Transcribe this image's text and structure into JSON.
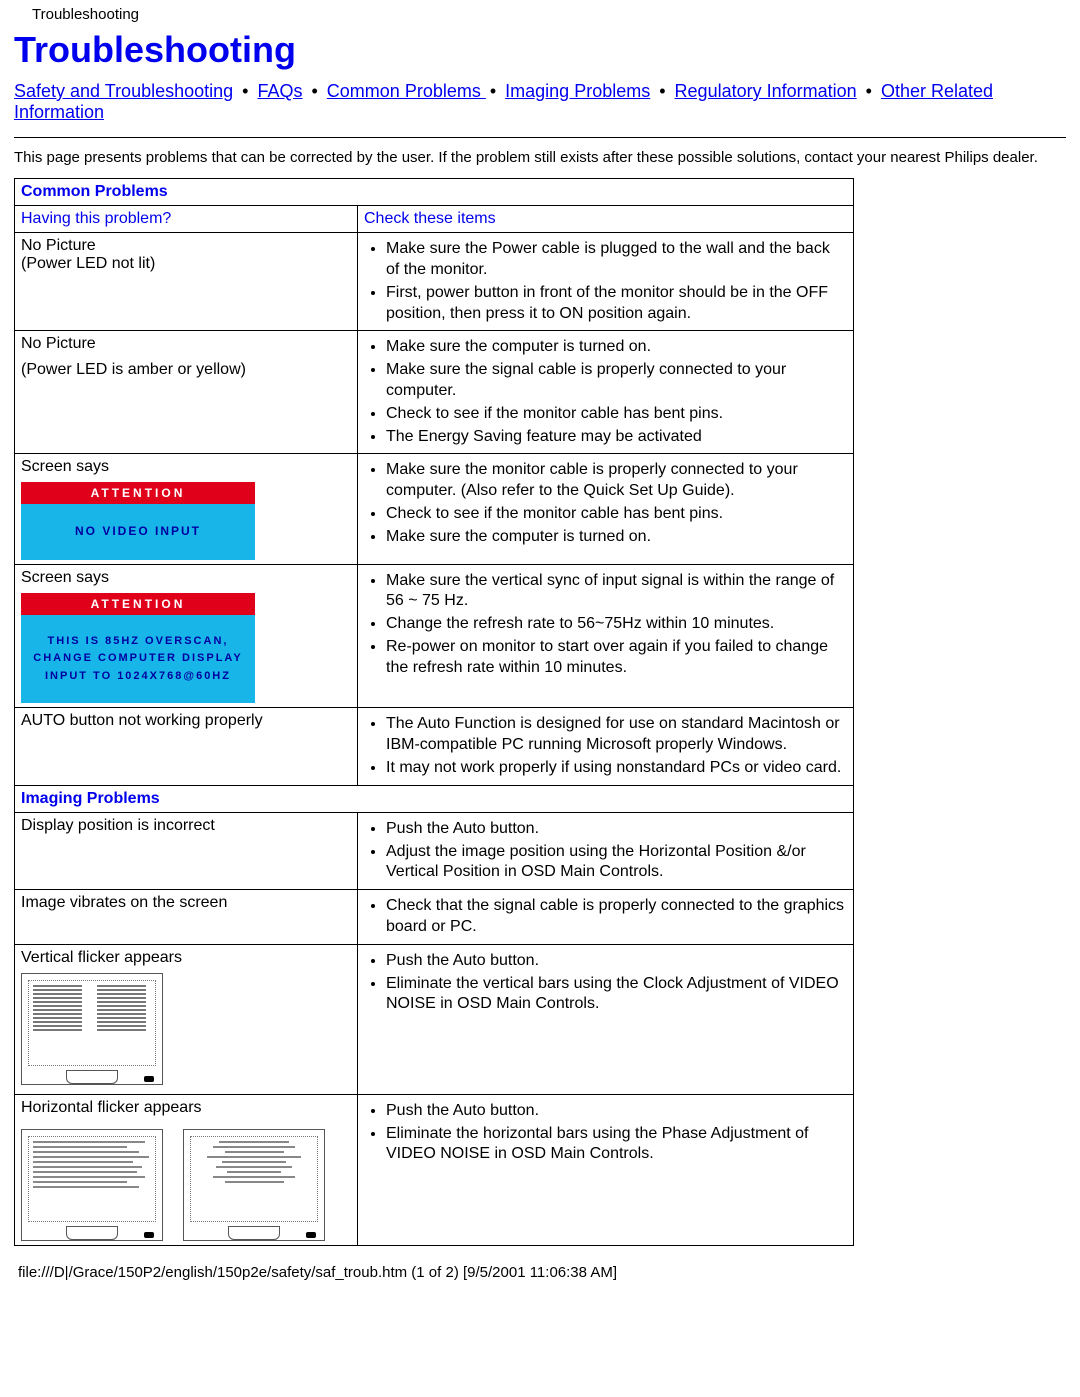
{
  "topbar": "Troubleshooting",
  "title": "Troubleshooting",
  "nav": {
    "safety": "Safety and Troubleshooting",
    "faqs": "FAQs",
    "common": "Common Problems ",
    "imaging": "Imaging Problems",
    "reg": "Regulatory Information",
    "other": "Other Related Information",
    "sep": " • "
  },
  "intro": "This page presents problems that can be corrected by the user. If the problem still exists after these possible solutions, contact your nearest Philips dealer.",
  "sect": {
    "common": "Common Problems",
    "imaging": "Imaging Problems"
  },
  "colhead": {
    "left": "Having this problem?",
    "right": "Check these items"
  },
  "rows": {
    "r1": {
      "p1": "No Picture",
      "p2": "(Power LED not lit)",
      "c1": "Make sure the Power cable is plugged to the wall and the back of the monitor.",
      "c2": "First, power button in front of the monitor should be in the OFF position, then press it to ON position again."
    },
    "r2": {
      "p1": "No Picture",
      "p2": "(Power LED is amber or yellow)",
      "c1": "Make sure the computer is turned on.",
      "c2": "Make sure the signal cable is properly connected to your computer.",
      "c3": "Check to see if the monitor cable has bent pins.",
      "c4": "The Energy Saving feature may be activated"
    },
    "r3": {
      "p1": "Screen says",
      "attn": "ATTENTION",
      "msg": "NO VIDEO INPUT",
      "c1": "Make sure the monitor cable is properly connected to your computer. (Also refer to the Quick Set Up Guide).",
      "c2": "Check to see if the monitor cable has bent pins.",
      "c3": "Make sure the computer is turned on."
    },
    "r4": {
      "p1": "Screen says",
      "attn": "ATTENTION",
      "msg1": "THIS IS 85HZ OVERSCAN,",
      "msg2": "CHANGE COMPUTER DISPLAY",
      "msg3": "INPUT TO 1024X768@60HZ",
      "c1": "Make sure the vertical sync of input signal is within the range of 56 ~ 75 Hz.",
      "c2": "Change the refresh rate to 56~75Hz within 10 minutes.",
      "c3": "Re-power on monitor to start over again if you failed to change the refresh rate within 10 minutes."
    },
    "r5": {
      "p1": "AUTO button not working properly",
      "c1": "The Auto Function is designed for use on standard Macintosh or IBM-compatible PC running Microsoft properly Windows.",
      "c2": "It may not work properly if using nonstandard PCs or video card."
    },
    "r6": {
      "p1": "Display position is incorrect",
      "c1": "Push the Auto button.",
      "c2": "Adjust the image position using the Horizontal Position &/or Vertical Position in OSD Main Controls."
    },
    "r7": {
      "p1": "Image vibrates on the screen",
      "c1": "Check that the signal cable is properly connected to the graphics board or PC."
    },
    "r8": {
      "p1": "Vertical flicker appears",
      "c1": "Push the Auto button.",
      "c2": "Eliminate the vertical bars using the Clock Adjustment of VIDEO NOISE in OSD Main Controls."
    },
    "r9": {
      "p1": "Horizontal flicker appears",
      "c1": "Push the Auto button.",
      "c2": "Eliminate the horizontal bars using the Phase Adjustment of VIDEO NOISE in OSD Main Controls."
    }
  },
  "footer": "file:///D|/Grace/150P2/english/150p2e/safety/saf_troub.htm (1 of 2) [9/5/2001 11:06:38 AM]"
}
